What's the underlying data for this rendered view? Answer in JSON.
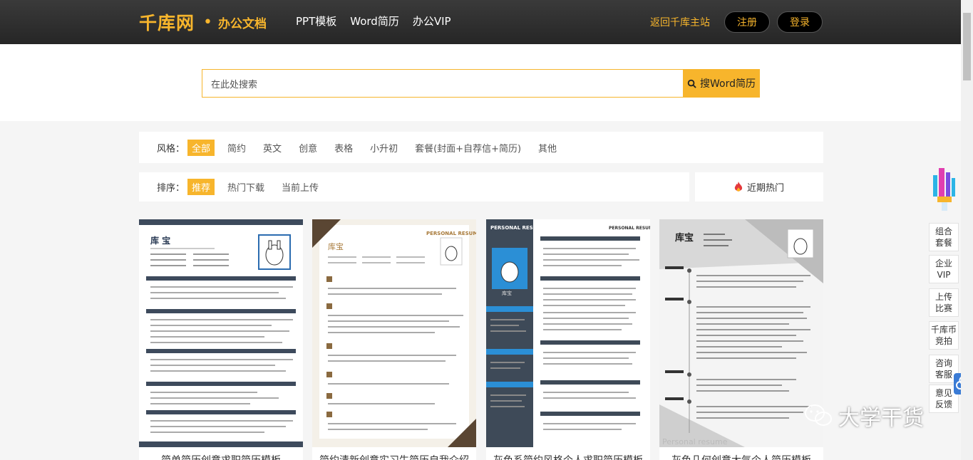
{
  "header": {
    "logo_main": "千库网",
    "logo_dot": "•",
    "logo_sub": "办公文档",
    "nav": [
      "PPT模板",
      "Word简历",
      "办公VIP"
    ],
    "back_link": "返回千库主站",
    "register": "注册",
    "login": "登录"
  },
  "search": {
    "placeholder": "在此处搜索",
    "button": "搜Word简历"
  },
  "filters": {
    "style_label": "风格：",
    "styles": [
      "全部",
      "简约",
      "英文",
      "创意",
      "表格",
      "小升初",
      "套餐(封面+自荐信+简历)",
      "其他"
    ],
    "sort_label": "排序：",
    "sorts": [
      "推荐",
      "热门下载",
      "当前上传"
    ],
    "hot": "近期热门"
  },
  "cards": [
    {
      "name": "库  宝",
      "title": "简单简历创意求职简历模板"
    },
    {
      "name": "库宝",
      "badge": "PERSONAL RESUME",
      "title": "简约清新创意实习生简历自我介绍"
    },
    {
      "name": "库宝",
      "badge": "PERSONAL RESUME",
      "title": "灰色系简约风格个人求职简历模板"
    },
    {
      "name": "库宝",
      "badge": "Personal resume",
      "title": "灰色几何创意大气个人简历模板"
    }
  ],
  "side": [
    "组合\n套餐",
    "企业\nVIP",
    "上传\n比赛",
    "千库币\n竞拍",
    "咨询\n客服",
    "意见\n反馈"
  ],
  "watermark": "大学干货",
  "colors": {
    "accent": "#f7b52c",
    "header_bg": "#2d2d2d"
  }
}
